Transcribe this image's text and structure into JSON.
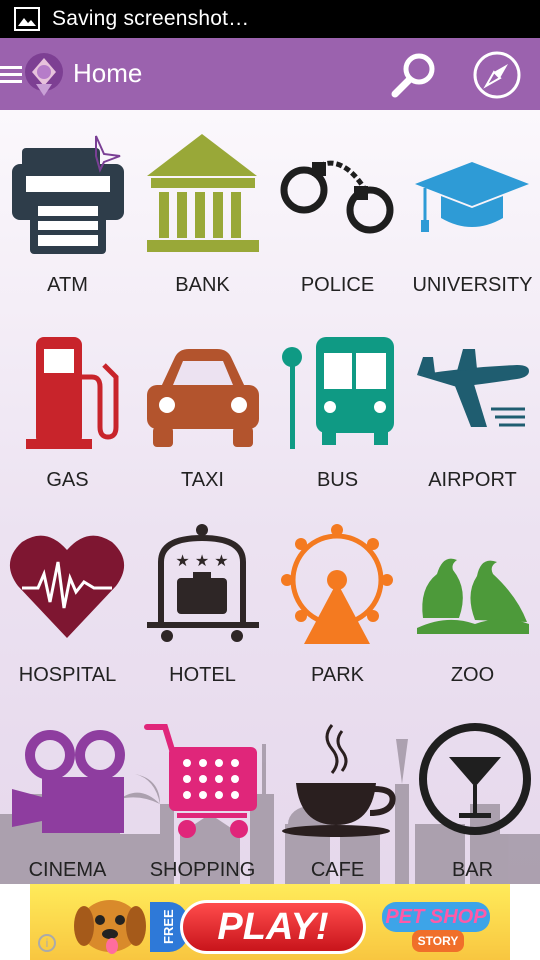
{
  "status_bar": {
    "notification_text": "Saving screenshot…",
    "notification_icon": "image-icon"
  },
  "action_bar": {
    "title": "Home",
    "menu_icon": "hamburger-icon",
    "logo_icon": "app-logo",
    "search_icon": "search-icon",
    "compass_icon": "compass-icon"
  },
  "colors": {
    "action_bar": "#9b62ae",
    "status_bar": "#000000",
    "content_bg": "#ece2f1"
  },
  "categories": [
    {
      "label": "ATM",
      "icon": "printer-icon",
      "color": "#2e3d4a"
    },
    {
      "label": "BANK",
      "icon": "bank-icon",
      "color": "#99a838"
    },
    {
      "label": "POLICE",
      "icon": "handcuffs-icon",
      "color": "#1e1e1e"
    },
    {
      "label": "UNIVERSITY",
      "icon": "graduation-cap-icon",
      "color": "#2e9bd6"
    },
    {
      "label": "GAS",
      "icon": "fuel-pump-icon",
      "color": "#c8242b"
    },
    {
      "label": "TAXI",
      "icon": "car-icon",
      "color": "#b3542d"
    },
    {
      "label": "BUS",
      "icon": "bus-icon",
      "color": "#0f9a84"
    },
    {
      "label": "AIRPORT",
      "icon": "airplane-icon",
      "color": "#1f5d70"
    },
    {
      "label": "HOSPITAL",
      "icon": "heart-pulse-icon",
      "color": "#7e1631"
    },
    {
      "label": "HOTEL",
      "icon": "hotel-bell-icon",
      "color": "#2e2626"
    },
    {
      "label": "PARK",
      "icon": "ferris-wheel-icon",
      "color": "#f47a20"
    },
    {
      "label": "ZOO",
      "icon": "birds-icon",
      "color": "#4d9a3a"
    },
    {
      "label": "CINEMA",
      "icon": "movie-camera-icon",
      "color": "#8e3d9f"
    },
    {
      "label": "SHOPPING",
      "icon": "shopping-cart-icon",
      "color": "#e0267a"
    },
    {
      "label": "CAFE",
      "icon": "coffee-cup-icon",
      "color": "#2a1f1f"
    },
    {
      "label": "BAR",
      "icon": "cocktail-icon",
      "color": "#1f1f1f"
    }
  ],
  "ad": {
    "free_label": "FREE",
    "play_label": "PLAY!",
    "brand_line1": "PET SHOP",
    "brand_line2": "STORY",
    "info_label": "i"
  }
}
